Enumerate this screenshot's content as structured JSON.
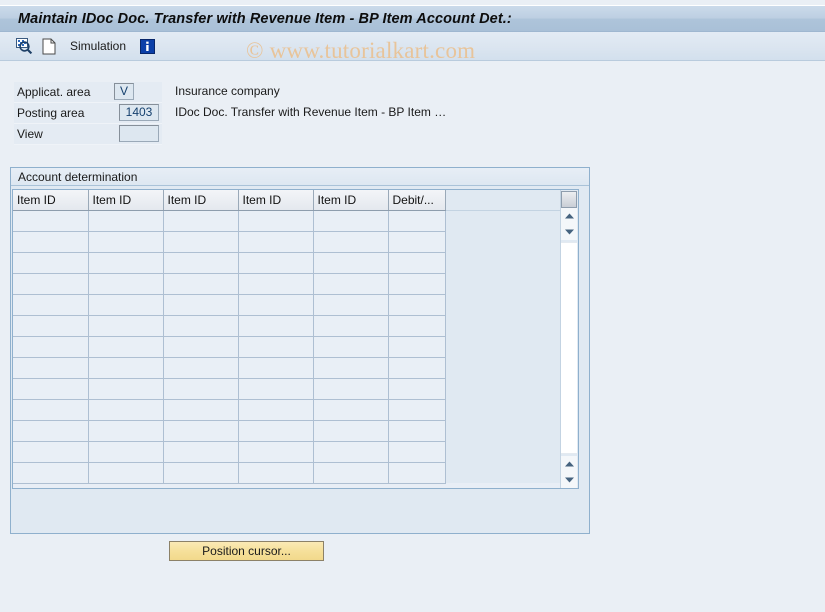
{
  "window": {
    "title": "Maintain IDoc Doc. Transfer with Revenue Item - BP Item Account Det.:"
  },
  "toolbar": {
    "display_icon": "magnifier-display-icon",
    "document_icon": "document-icon",
    "simulation_label": "Simulation",
    "info_icon": "info-icon"
  },
  "watermark": {
    "text": "© www.tutorialkart.com",
    "color": "#e8c49a"
  },
  "header_fields": [
    {
      "label": "Applicat. area",
      "value": "V",
      "placeholder": "",
      "description": "Insurance company"
    },
    {
      "label": "Posting area",
      "value": "1403",
      "placeholder": "",
      "description": "IDoc Doc. Transfer with Revenue Item - BP Item …"
    },
    {
      "label": "View",
      "value": "",
      "placeholder": "",
      "description": ""
    }
  ],
  "group_box": {
    "title": "Account determination"
  },
  "table": {
    "columns": [
      "Item ID",
      "Item ID",
      "Item ID",
      "Item ID",
      "Item ID",
      "Debit/..."
    ],
    "rows": [
      [
        "",
        "",
        "",
        "",
        "",
        ""
      ],
      [
        "",
        "",
        "",
        "",
        "",
        ""
      ],
      [
        "",
        "",
        "",
        "",
        "",
        ""
      ],
      [
        "",
        "",
        "",
        "",
        "",
        ""
      ],
      [
        "",
        "",
        "",
        "",
        "",
        ""
      ],
      [
        "",
        "",
        "",
        "",
        "",
        ""
      ],
      [
        "",
        "",
        "",
        "",
        "",
        ""
      ],
      [
        "",
        "",
        "",
        "",
        "",
        ""
      ],
      [
        "",
        "",
        "",
        "",
        "",
        ""
      ],
      [
        "",
        "",
        "",
        "",
        "",
        ""
      ],
      [
        "",
        "",
        "",
        "",
        "",
        ""
      ],
      [
        "",
        "",
        "",
        "",
        "",
        ""
      ],
      [
        "",
        "",
        "",
        "",
        "",
        ""
      ]
    ],
    "select_all_label": ""
  },
  "footer": {
    "position_cursor_label": "Position cursor..."
  },
  "colors": {
    "background": "#eaeff5",
    "title_bar": "#b6cadf",
    "panel_border": "#8fb0cd",
    "field_value_text": "#15406e",
    "button_yellow": "#f6e09b"
  }
}
